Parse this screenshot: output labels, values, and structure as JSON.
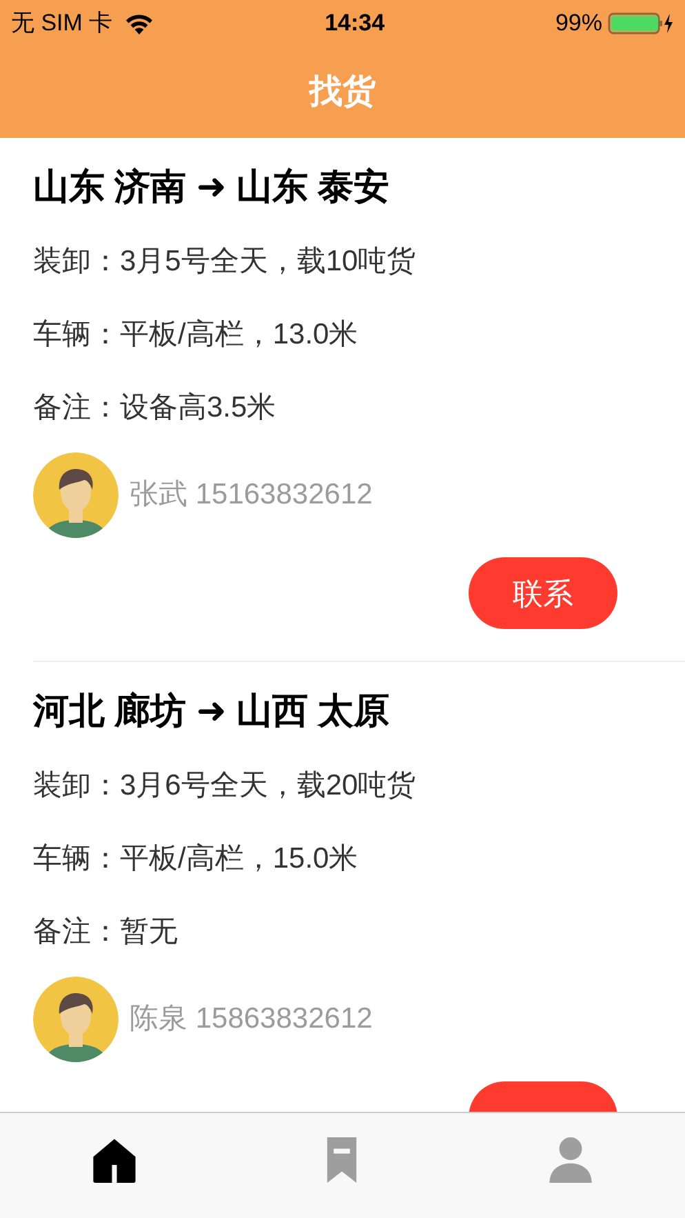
{
  "status_bar": {
    "carrier": "无 SIM 卡",
    "time": "14:34",
    "battery_percent": "99%",
    "battery": {
      "level": 0.99,
      "charging": true
    }
  },
  "nav_bar": {
    "title": "找货"
  },
  "cargo_list": [
    {
      "route": "山东 济南 ➜ 山东 泰安",
      "details": [
        "装卸：3月5号全天，载10吨货",
        "车辆：平板/高栏，13.0米",
        "备注：设备高3.5米"
      ],
      "contact": "张武 15163832612",
      "contact_button": "联系"
    },
    {
      "route": "河北 廊坊 ➜ 山西 太原",
      "details": [
        "装卸：3月6号全天，载20吨货",
        "车辆：平板/高栏，15.0米",
        "备注：暂无"
      ],
      "contact": "陈泉 15863832612"
    }
  ],
  "tab_bar": [
    {
      "kind": "home",
      "selected": true
    },
    {
      "kind": "bookmark",
      "selected": false
    },
    {
      "kind": "person",
      "selected": false
    }
  ]
}
